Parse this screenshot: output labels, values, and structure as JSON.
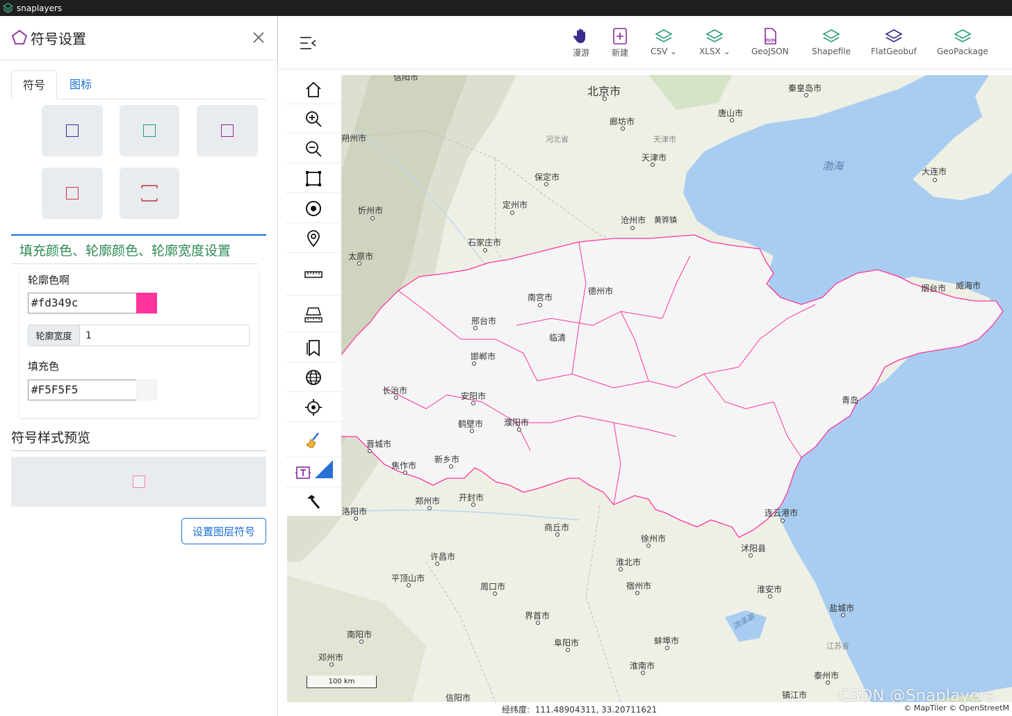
{
  "window": {
    "title": "snaplayers"
  },
  "panel": {
    "title": "符号设置",
    "tabs": [
      "符号",
      "图标"
    ],
    "symbols": [
      {
        "name": "symbol-blue",
        "color": "#2b2fa0"
      },
      {
        "name": "symbol-teal",
        "color": "#1f9a8a"
      },
      {
        "name": "symbol-purple",
        "color": "#9a1fa0"
      },
      {
        "name": "symbol-red",
        "color": "#d0304a"
      },
      {
        "name": "symbol-red-open",
        "color": "#c0303a"
      }
    ],
    "section_title": "填充颜色、轮廓颜色、轮廓宽度设置",
    "stroke_color_label": "轮廓色啊",
    "stroke_color_value": "#fd349c",
    "stroke_width_label": "轮廓宽度",
    "stroke_width_value": "1",
    "fill_color_label": "填充色",
    "fill_color_value": "#F5F5F5",
    "preview_title": "符号样式预览",
    "apply_button": "设置图层符号"
  },
  "toolbar": {
    "buttons": [
      {
        "label": "漫游",
        "icon": "hand-icon"
      },
      {
        "label": "新建",
        "icon": "new-icon"
      },
      {
        "label": "CSV",
        "icon": "layers-icon",
        "dropdown": true
      },
      {
        "label": "XLSX",
        "icon": "layers-icon",
        "dropdown": true
      },
      {
        "label": "GeoJSON",
        "icon": "json-file-icon"
      },
      {
        "label": "Shapefile",
        "icon": "layers-icon"
      },
      {
        "label": "FlatGeobuf",
        "icon": "layers-icon"
      },
      {
        "label": "GeoPackage",
        "icon": "layers-icon"
      }
    ]
  },
  "side_tools": [
    "home-icon",
    "zoom-in-icon",
    "zoom-out-icon",
    "extent-icon",
    "target-icon",
    "marker-icon",
    "ruler-icon",
    "area-measure-icon",
    "bookmark-icon",
    "globe-icon",
    "locate-icon",
    "clear-icon",
    "text-icon",
    "hammer-icon"
  ],
  "map": {
    "labels": [
      {
        "text": "北京市",
        "size": "big"
      },
      {
        "text": "秦皇岛市"
      },
      {
        "text": "唐山市"
      },
      {
        "text": "廊坊市"
      },
      {
        "text": "河北省",
        "style": "light"
      },
      {
        "text": "天津市",
        "style": "light"
      },
      {
        "text": "天津市"
      },
      {
        "text": "渤海",
        "style": "sea"
      },
      {
        "text": "大连市"
      },
      {
        "text": "朔州市"
      },
      {
        "text": "保定市"
      },
      {
        "text": "忻州市"
      },
      {
        "text": "定州市"
      },
      {
        "text": "沧州市"
      },
      {
        "text": "黄骅镇"
      },
      {
        "text": "石家庄市"
      },
      {
        "text": "太原市"
      },
      {
        "text": "烟台市"
      },
      {
        "text": "威海市"
      },
      {
        "text": "德州市"
      },
      {
        "text": "南宫市"
      },
      {
        "text": "邢台市"
      },
      {
        "text": "临清"
      },
      {
        "text": "邯郸市"
      },
      {
        "text": "长治市"
      },
      {
        "text": "安阳市"
      },
      {
        "text": "青岛"
      },
      {
        "text": "鹤壁市"
      },
      {
        "text": "濮阳市"
      },
      {
        "text": "晋城市"
      },
      {
        "text": "焦作市"
      },
      {
        "text": "新乡市"
      },
      {
        "text": "郑州市"
      },
      {
        "text": "开封市"
      },
      {
        "text": "洛阳市"
      },
      {
        "text": "连云港市"
      },
      {
        "text": "商丘市"
      },
      {
        "text": "徐州市"
      },
      {
        "text": "许昌市"
      },
      {
        "text": "沭阳县"
      },
      {
        "text": "淮北市"
      },
      {
        "text": "平顶山市"
      },
      {
        "text": "宿州市"
      },
      {
        "text": "周口市"
      },
      {
        "text": "淮安市"
      },
      {
        "text": "界首市"
      },
      {
        "text": "盐城市"
      },
      {
        "text": "洪泽湖",
        "style": "sea"
      },
      {
        "text": "南阳市"
      },
      {
        "text": "阜阳市"
      },
      {
        "text": "蚌埠市"
      },
      {
        "text": "江苏省",
        "style": "light"
      },
      {
        "text": "邓州市"
      },
      {
        "text": "淮南市"
      },
      {
        "text": "泰州市"
      },
      {
        "text": "信阳市"
      },
      {
        "text": "镇江市"
      }
    ],
    "scale": "100 km",
    "coords_label": "经纬度:",
    "coords_value": "111.48904311, 33.20711621",
    "attribution": "© MapTiler © OpenStreetM",
    "watermark": "CSDN @Snaplayers",
    "layer_stroke": "#fd349c",
    "layer_fill": "#F5F5F5"
  }
}
